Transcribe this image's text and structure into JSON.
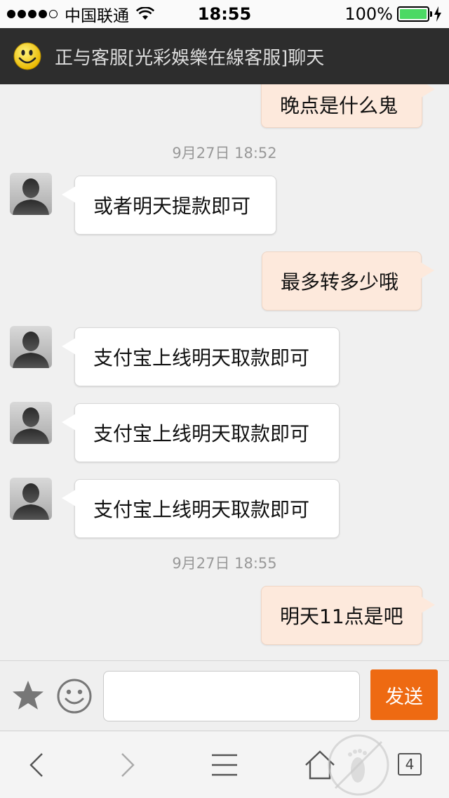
{
  "status_bar": {
    "carrier": "中国联通",
    "time": "18:55",
    "battery_percent": "100%",
    "battery_level": 1.0,
    "signal_bars_filled": 4,
    "signal_bars_total": 5
  },
  "header": {
    "title": "正与客服[光彩娛樂在線客服]聊天"
  },
  "messages": [
    {
      "type": "bubble",
      "side": "right",
      "text": "晚点是什么鬼"
    },
    {
      "type": "timestamp",
      "text": "9月27日 18:52"
    },
    {
      "type": "bubble",
      "side": "left",
      "text": "或者明天提款即可"
    },
    {
      "type": "bubble",
      "side": "right",
      "text": "最多转多少哦"
    },
    {
      "type": "bubble",
      "side": "left",
      "text": "支付宝上线明天取款即可"
    },
    {
      "type": "bubble",
      "side": "left",
      "text": "支付宝上线明天取款即可"
    },
    {
      "type": "bubble",
      "side": "left",
      "text": "支付宝上线明天取款即可"
    },
    {
      "type": "timestamp",
      "text": "9月27日 18:55"
    },
    {
      "type": "bubble",
      "side": "right",
      "text": "明天11点是吧"
    }
  ],
  "input_bar": {
    "input_value": "",
    "send_label": "发送"
  },
  "toolbar": {
    "tabs_count": "4"
  },
  "colors": {
    "header_bg": "#2d2d2d",
    "send_button": "#ee6a12",
    "right_bubble": "#fde9dc",
    "left_bubble": "#ffffff",
    "battery": "#4cd964"
  },
  "icons": {
    "header": "smiley-face-icon",
    "avatar": "person-silhouette-icon",
    "input_left": [
      "star-icon",
      "emoji-icon"
    ],
    "toolbar": [
      "back-arrow-icon",
      "forward-arrow-icon",
      "menu-icon",
      "home-icon",
      "tabs-icon"
    ]
  }
}
